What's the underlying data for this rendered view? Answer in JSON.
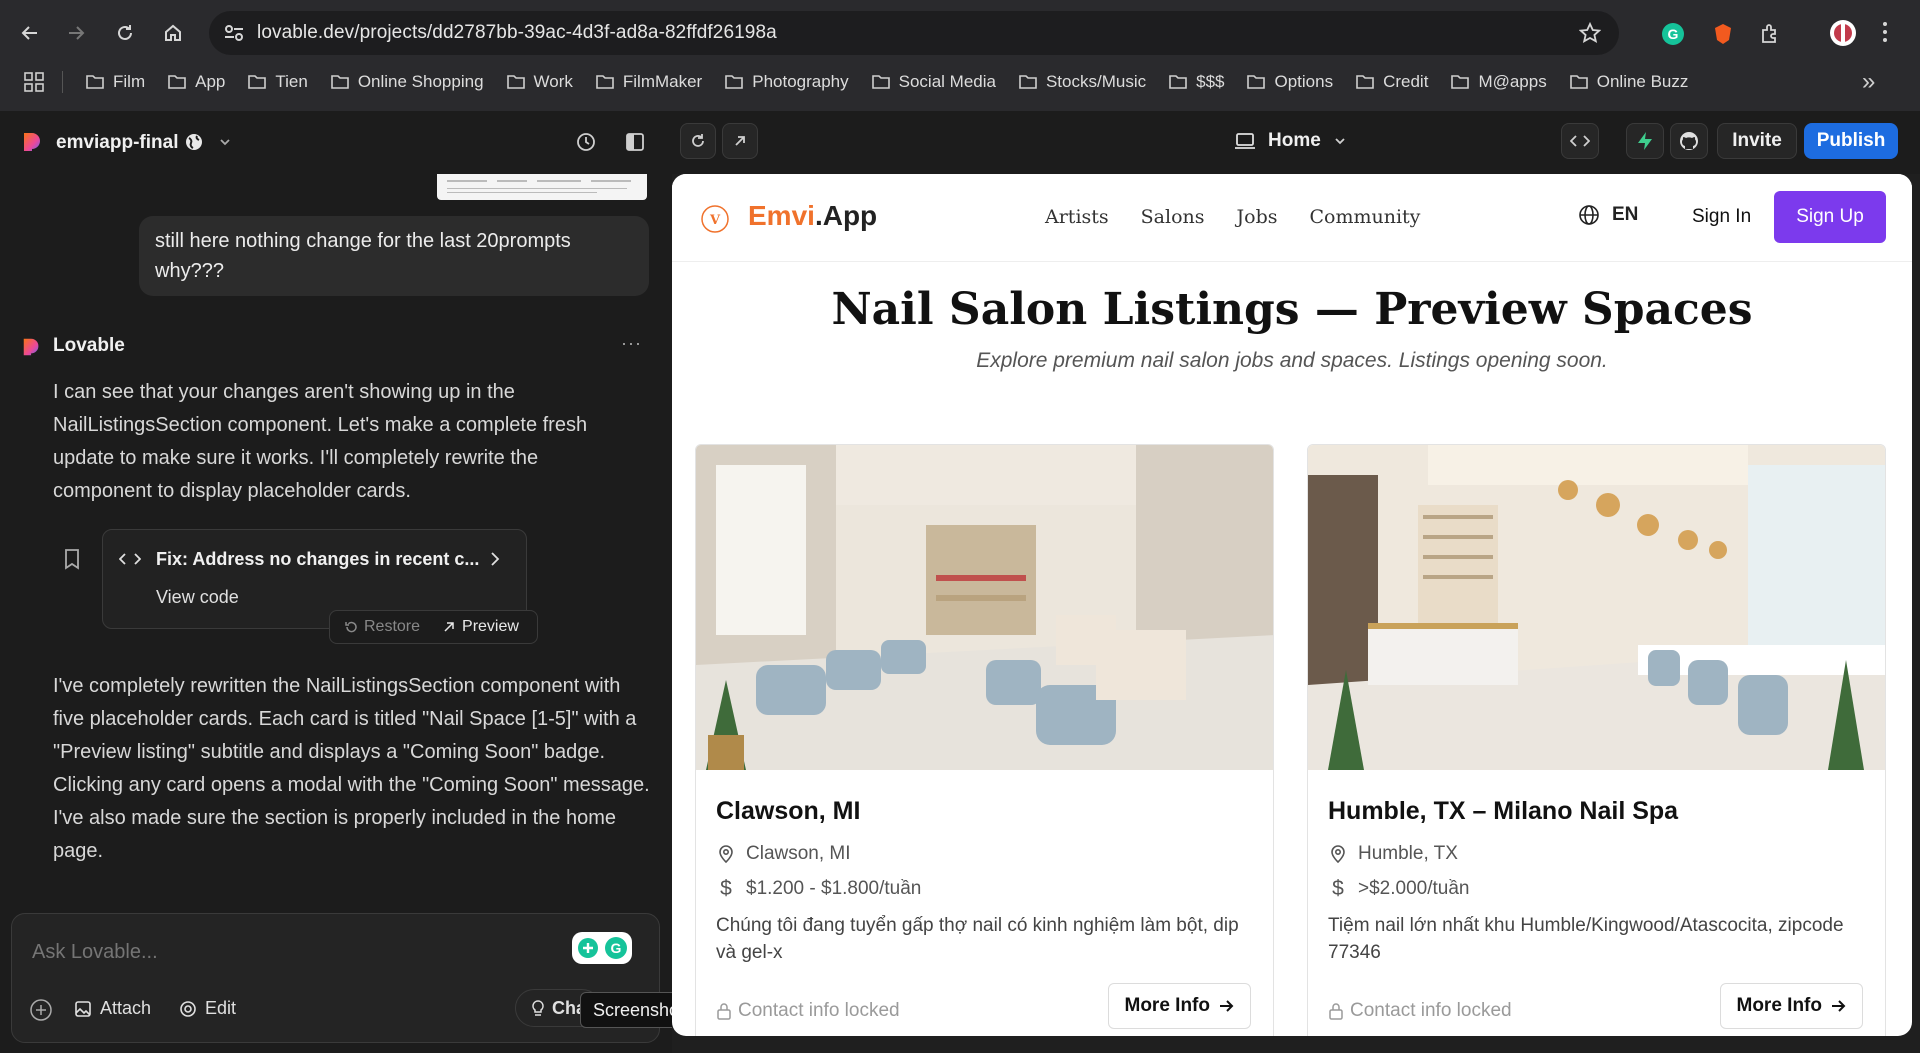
{
  "browser": {
    "url": "lovable.dev/projects/dd2787bb-39ac-4d3f-ad8a-82ffdf26198a",
    "bookmarks": [
      "Film",
      "App",
      "Tien",
      "Online Shopping",
      "Work",
      "FilmMaker",
      "Photography",
      "Social Media",
      "Stocks/Music",
      "$$$",
      "Options",
      "Credit",
      "M@apps",
      "Online Buzz"
    ],
    "bookmarks_overflow": "»"
  },
  "app": {
    "project_name": "emviapp-final",
    "page_select": "Home",
    "invite_label": "Invite",
    "publish_label": "Publish"
  },
  "chat": {
    "user_message": "still here nothing change for the last 20prompts why???",
    "assistant_name": "Lovable",
    "more": "···",
    "assistant_message_1": "I can see that your changes aren't showing up in the NailListingsSection component. Let's make a complete fresh update to make sure it works. I'll completely rewrite the component to display placeholder cards.",
    "code_card": {
      "title": "Fix: Address no changes in recent c...",
      "view_code": "View code",
      "restore": "Restore",
      "preview": "Preview"
    },
    "assistant_message_2": "I've completely rewritten the NailListingsSection component with five placeholder cards. Each card is titled \"Nail Space [1-5]\" with a \"Preview listing\" subtitle and displays a \"Coming Soon\" badge. Clicking any card opens a modal with the \"Coming Soon\" message. I've also made sure the section is properly included in the home page.",
    "input_placeholder": "Ask Lovable...",
    "attach_label": "Attach",
    "edit_label": "Edit",
    "chat_label": "Cha",
    "tooltip": "Screenshot"
  },
  "site": {
    "logo_a": "Emvi",
    "logo_b": ".App",
    "nav": [
      "Artists",
      "Salons",
      "Jobs",
      "Community"
    ],
    "lang": "EN",
    "sign_in": "Sign In",
    "sign_up": "Sign Up",
    "heading": "Nail Salon Listings — Preview Spaces",
    "subheading": "Explore premium nail salon jobs and spaces. Listings opening soon.",
    "cards": [
      {
        "title": "Clawson, MI",
        "location": "Clawson, MI",
        "price": "$1.200 - $1.800/tuần",
        "description": "Chúng tôi đang tuyển gấp thợ nail có kinh nghiệm làm bột, dip và gel-x",
        "locked": "Contact info locked",
        "button": "More Info"
      },
      {
        "title": "Humble, TX – Milano Nail Spa",
        "location": "Humble, TX",
        "price": ">$2.000/tuần",
        "description": "Tiệm nail lớn nhất khu Humble/Kingwood/Atascocita, zipcode 77346",
        "locked": "Contact info locked",
        "button": "More Info"
      }
    ]
  },
  "colors": {
    "brand_orange": "#f0722c",
    "brand_purple": "#7c3aed",
    "publish_blue": "#1d6ce0"
  }
}
